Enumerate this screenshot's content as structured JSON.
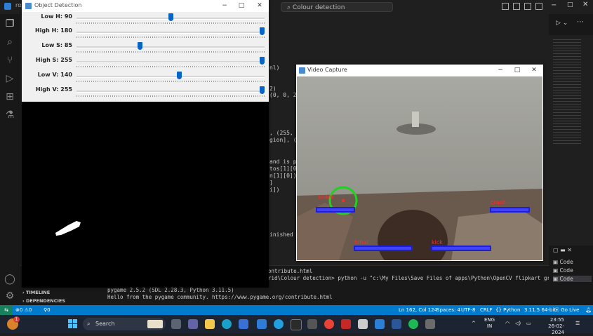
{
  "vscode": {
    "search_text": "Colour detection",
    "activity_icons": [
      "explorer-icon",
      "search-icon",
      "source-control-icon",
      "run-debug-icon",
      "extensions-icon",
      "testing-icon"
    ],
    "code_fragments": [
      "nl)",
      "2)",
      "(0, 0, 2",
      ", (255, 0",
      "gion], (r",
      "and is pl",
      "tos[1][0]",
      "n[1][0])",
      "]",
      "i])",
      "inished"
    ],
    "terminal_lines": [
      "ontribute.html",
      "rid\\Colour detection> python -u \"c:\\My Files\\Save Files of apps\\Python\\OpenCV flipkart grid\\Colou",
      "pygame 2.5.2 (SDL 2.28.3, Python 3.11.5)",
      "Hello from the pygame community. https://www.pygame.org/contribute.html"
    ],
    "panel_items": [
      "Code",
      "Code",
      "Code"
    ],
    "sidebar_sections": [
      "TIMELINE",
      "DEPENDENCIES"
    ],
    "status": {
      "errors": "0",
      "warnings": "0",
      "ports": "0",
      "position": "Ln 162, Col 124",
      "spaces": "Spaces: 4",
      "encoding": "UTF-8",
      "eol": "CRLF",
      "language": "Python",
      "interpreter": "3.11.5 64-bit",
      "golive": "Go Live"
    }
  },
  "object_detection": {
    "title": "Object Detection",
    "trackbars": [
      {
        "label": "Low H: 90",
        "fraction": 0.502
      },
      {
        "label": "High H: 180",
        "fraction": 1.0
      },
      {
        "label": "Low S: 85",
        "fraction": 0.333
      },
      {
        "label": "High S: 255",
        "fraction": 1.0
      },
      {
        "label": "Low V: 140",
        "fraction": 0.549
      },
      {
        "label": "High V: 255",
        "fraction": 1.0
      }
    ]
  },
  "video_capture": {
    "title": "Video Capture",
    "hud": [
      {
        "label": "snare",
        "name": "snare-zone"
      },
      {
        "label": "crash",
        "name": "crash-zone"
      },
      {
        "label": "hihat",
        "name": "hihat-zone"
      },
      {
        "label": "kick",
        "name": "kick-zone"
      }
    ]
  },
  "taskbar": {
    "search_placeholder": "Search",
    "lang": "ENG",
    "region": "IN",
    "time": "23:55",
    "date": "26-02-2024",
    "notification_count": "1"
  }
}
